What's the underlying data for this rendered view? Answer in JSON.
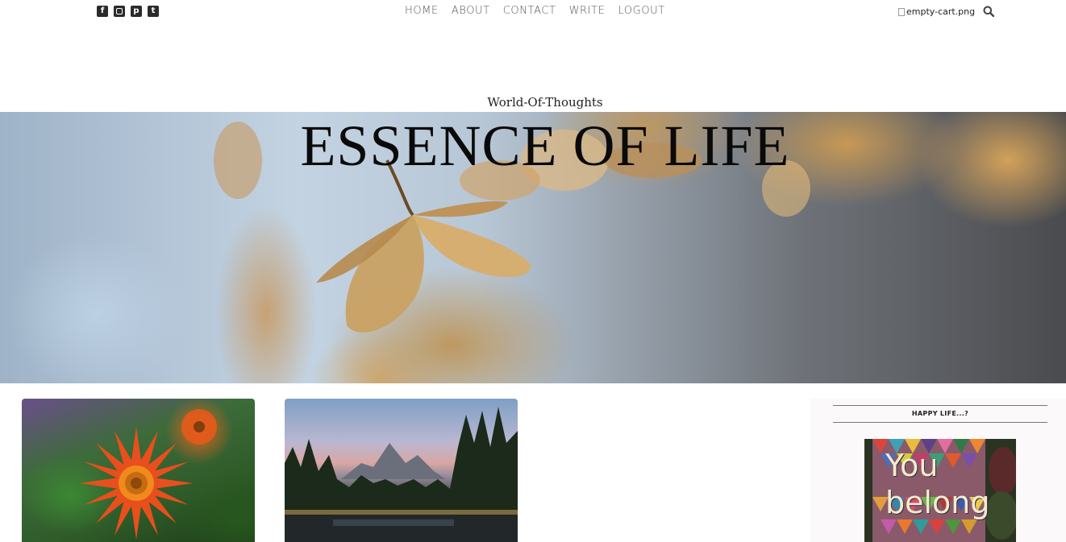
{
  "social": {
    "icons": [
      "facebook-icon",
      "instagram-icon",
      "pinterest-icon",
      "twitter-icon"
    ]
  },
  "nav": {
    "items": [
      {
        "label": "HOME"
      },
      {
        "label": "ABOUT"
      },
      {
        "label": "CONTACT"
      },
      {
        "label": "WRITE"
      },
      {
        "label": "LOGOUT"
      }
    ]
  },
  "cart": {
    "alt_text": "empty-cart.png"
  },
  "header": {
    "subtitle": "World-Of-Thoughts",
    "title": "ESSENCE OF LIFE"
  },
  "sidebar": {
    "title": "HAPPY LIFE...?",
    "image_text_line1": "You",
    "image_text_line2": "belong"
  },
  "colors": {
    "text": "#333333",
    "nav_text": "#555555",
    "sidebar_bg": "#fbf9f9"
  }
}
